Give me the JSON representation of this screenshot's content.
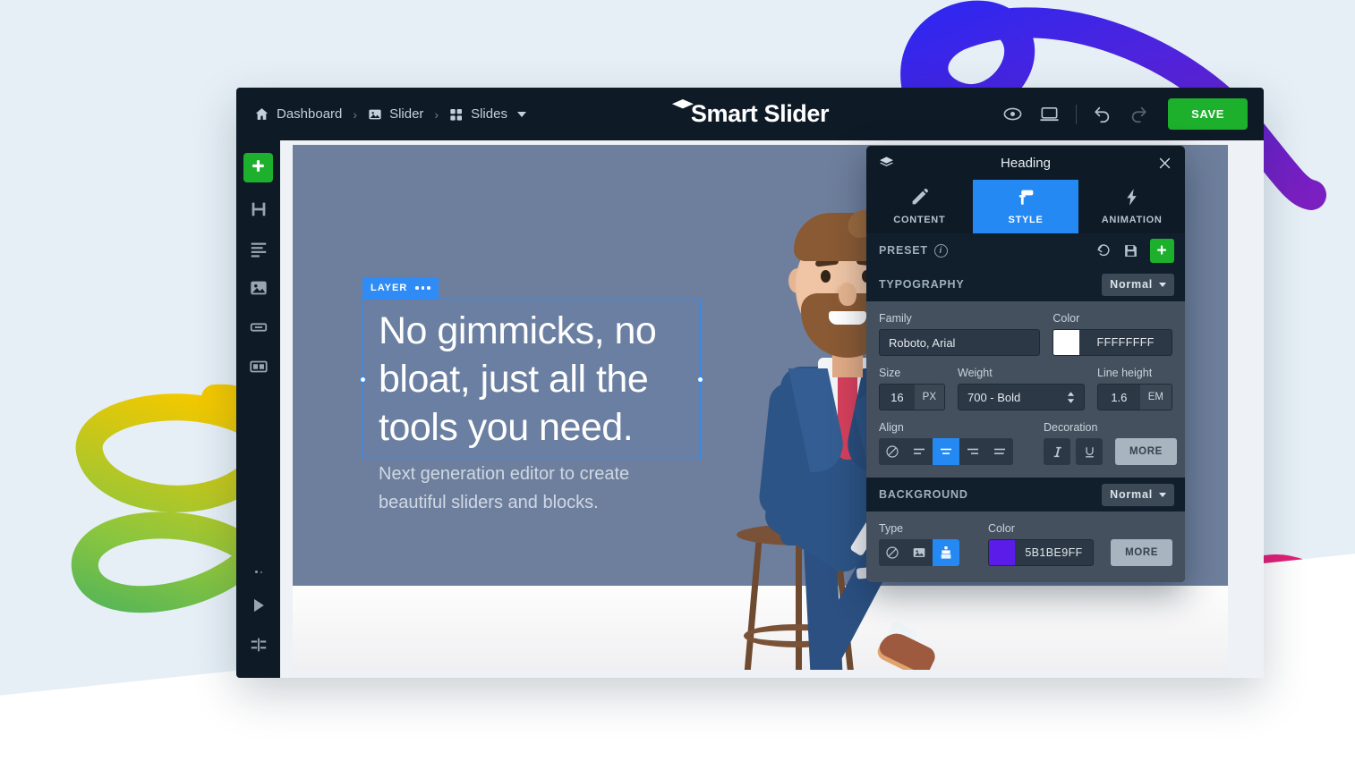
{
  "app": {
    "logo_text": "Smart Slider",
    "logo_icon": "graduation-cap-icon"
  },
  "breadcrumb": {
    "items": [
      {
        "label": "Dashboard",
        "icon": "home-icon"
      },
      {
        "label": "Slider",
        "icon": "image-icon"
      },
      {
        "label": "Slides",
        "icon": "grid-icon",
        "has_caret": true
      }
    ],
    "separator": "›"
  },
  "toolbar": {
    "preview_icon": "eye-icon",
    "device_icon": "desktop-icon",
    "undo_icon": "undo-icon",
    "redo_icon": "redo-icon",
    "save_label": "SAVE",
    "save_color": "#1cb02c"
  },
  "rail": {
    "items": [
      {
        "name": "add-layer",
        "icon": "plus-icon",
        "label": "Add layer"
      },
      {
        "name": "heading-layer",
        "icon": "heading-icon",
        "label": "Heading"
      },
      {
        "name": "text-layer",
        "icon": "text-icon",
        "label": "Text"
      },
      {
        "name": "image-layer",
        "icon": "image-icon",
        "label": "Image"
      },
      {
        "name": "button-layer",
        "icon": "button-icon",
        "label": "Button"
      },
      {
        "name": "row-layer",
        "icon": "columns-icon",
        "label": "Row"
      }
    ],
    "bottom": [
      {
        "name": "more-options",
        "icon": "dots-icon"
      },
      {
        "name": "play-preview",
        "icon": "play-icon"
      },
      {
        "name": "timeline",
        "icon": "timeline-icon"
      }
    ]
  },
  "canvas": {
    "layer_tag": "LAYER",
    "layer_menu_icon": "dots-icon",
    "headline": "No gimmicks, no bloat, just all the tools you need.",
    "subline": "Next generation editor to create beautiful sliders and blocks.",
    "background_color": "#6e7f9d"
  },
  "panel": {
    "title": "Heading",
    "layers_icon": "layers-icon",
    "close_icon": "close-icon",
    "tabs": [
      {
        "label": "CONTENT",
        "icon": "pencil-icon",
        "active": false
      },
      {
        "label": "STYLE",
        "icon": "paint-roller-icon",
        "active": true
      },
      {
        "label": "ANIMATION",
        "icon": "bolt-icon",
        "active": false
      }
    ],
    "preset": {
      "title": "PRESET",
      "info_icon": "info-icon",
      "reset_icon": "reset-icon",
      "save_icon": "floppy-disk-icon",
      "add_icon": "plus-icon"
    },
    "typography": {
      "title": "TYPOGRAPHY",
      "state": "Normal",
      "family_label": "Family",
      "family_value": "Roboto, Arial",
      "color_label": "Color",
      "color_value": "FFFFFFFF",
      "color_swatch": "#ffffff",
      "size_label": "Size",
      "size_value": "16",
      "size_unit": "PX",
      "weight_label": "Weight",
      "weight_value": "700 - Bold",
      "lineheight_label": "Line height",
      "lineheight_value": "1.6",
      "lineheight_unit": "EM",
      "align_label": "Align",
      "align_options": [
        {
          "name": "align-none",
          "icon": "no-icon",
          "active": false
        },
        {
          "name": "align-left",
          "icon": "align-left-icon",
          "active": false
        },
        {
          "name": "align-center",
          "icon": "align-center-icon",
          "active": true
        },
        {
          "name": "align-right",
          "icon": "align-right-icon",
          "active": false
        },
        {
          "name": "align-justify",
          "icon": "align-justify-icon",
          "active": false
        }
      ],
      "decoration_label": "Decoration",
      "decoration_options": [
        {
          "name": "italic",
          "icon": "italic-icon",
          "active": false
        },
        {
          "name": "underline",
          "icon": "underline-icon",
          "active": false
        }
      ],
      "more_label": "MORE"
    },
    "background": {
      "title": "BACKGROUND",
      "state": "Normal",
      "type_label": "Type",
      "type_options": [
        {
          "name": "bg-none",
          "icon": "no-icon",
          "active": false
        },
        {
          "name": "bg-image",
          "icon": "image-icon",
          "active": false
        },
        {
          "name": "bg-color",
          "icon": "paint-bucket-icon",
          "active": true
        }
      ],
      "color_label": "Color",
      "color_value": "5B1BE9FF",
      "color_swatch": "#5b1be9",
      "more_label": "MORE"
    }
  },
  "decor": {
    "blue_swirl": [
      "#2f27f0",
      "#7b1fc0"
    ],
    "green_swirl": [
      "#f2c800",
      "#0a9e7a"
    ],
    "pink_swirl": [
      "#e01e79",
      "#f5832a"
    ],
    "yellow_arc": [
      "#f9c22e",
      "#f58a2a"
    ]
  }
}
